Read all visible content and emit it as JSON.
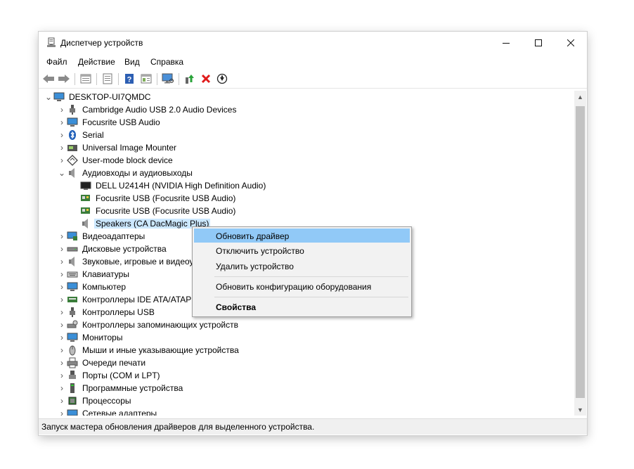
{
  "window": {
    "title": "Диспетчер устройств",
    "controls": {
      "minimize": "minimize-icon",
      "maximize": "maximize-icon",
      "close": "close-icon"
    }
  },
  "menu": [
    "Файл",
    "Действие",
    "Вид",
    "Справка"
  ],
  "toolbar_icons": [
    "back-arrow-icon",
    "forward-arrow-icon",
    "properties-icon",
    "list-view-icon",
    "help-icon",
    "device-view-icon",
    "scan-hardware-icon",
    "update-driver-icon",
    "uninstall-device-icon",
    "disable-device-icon"
  ],
  "tree": {
    "root": "DESKTOP-UI7QMDC",
    "items": [
      {
        "label": "Cambridge Audio USB 2.0 Audio Devices",
        "icon": "usb-device-icon",
        "expanded": false,
        "level": 1
      },
      {
        "label": "Focusrite USB Audio",
        "icon": "monitor-icon",
        "expanded": false,
        "level": 1
      },
      {
        "label": "Serial",
        "icon": "bluetooth-icon",
        "expanded": false,
        "level": 1
      },
      {
        "label": "Universal Image Mounter",
        "icon": "image-device-icon",
        "expanded": false,
        "level": 1
      },
      {
        "label": "User-mode block device",
        "icon": "block-device-icon",
        "expanded": false,
        "level": 1
      },
      {
        "label": "Аудиовходы и аудиовыходы",
        "icon": "speaker-icon",
        "expanded": true,
        "level": 1
      },
      {
        "label": "DELL U2414H (NVIDIA High Definition Audio)",
        "icon": "monitor-audio-icon",
        "level": 2
      },
      {
        "label": "Focusrite USB (Focusrite USB Audio)",
        "icon": "audio-card-icon",
        "level": 2
      },
      {
        "label": "Focusrite USB (Focusrite USB Audio)",
        "icon": "audio-card-icon",
        "level": 2
      },
      {
        "label": "Speakers (CA DacMagic Plus)",
        "icon": "speaker-icon",
        "level": 2,
        "selected": true
      },
      {
        "label": "Видеоадаптеры",
        "icon": "display-adapter-icon",
        "expanded": false,
        "level": 1
      },
      {
        "label": "Дисковые устройства",
        "icon": "disk-drive-icon",
        "expanded": false,
        "level": 1
      },
      {
        "label": "Звуковые, игровые и видеоустройства",
        "icon": "speaker-icon",
        "expanded": false,
        "level": 1
      },
      {
        "label": "Клавиатуры",
        "icon": "keyboard-icon",
        "expanded": false,
        "level": 1
      },
      {
        "label": "Компьютер",
        "icon": "computer-icon",
        "expanded": false,
        "level": 1
      },
      {
        "label": "Контроллеры IDE ATA/ATAPI",
        "icon": "ide-controller-icon",
        "expanded": false,
        "level": 1
      },
      {
        "label": "Контроллеры USB",
        "icon": "usb-controller-icon",
        "expanded": false,
        "level": 1
      },
      {
        "label": "Контроллеры запоминающих устройств",
        "icon": "storage-controller-icon",
        "expanded": false,
        "level": 1
      },
      {
        "label": "Мониторы",
        "icon": "monitor-icon",
        "expanded": false,
        "level": 1
      },
      {
        "label": "Мыши и иные указывающие устройства",
        "icon": "mouse-icon",
        "expanded": false,
        "level": 1
      },
      {
        "label": "Очереди печати",
        "icon": "printer-icon",
        "expanded": false,
        "level": 1
      },
      {
        "label": "Порты (COM и LPT)",
        "icon": "port-icon",
        "expanded": false,
        "level": 1
      },
      {
        "label": "Программные устройства",
        "icon": "software-device-icon",
        "expanded": false,
        "level": 1
      },
      {
        "label": "Процессоры",
        "icon": "processor-icon",
        "expanded": false,
        "level": 1
      },
      {
        "label": "Сетевые адаптеры",
        "icon": "network-adapter-icon",
        "expanded": false,
        "level": 1
      }
    ]
  },
  "context_menu": {
    "items": [
      "Обновить драйвер",
      "Отключить устройство",
      "Удалить устройство",
      "Обновить конфигурацию оборудования",
      "Свойства"
    ],
    "highlighted": "Обновить драйвер"
  },
  "status": "Запуск мастера обновления драйверов для выделенного устройства.",
  "colors": {
    "selection": "#cce8ff",
    "menu_highlight": "#91c9f7",
    "uninstall_red": "#e01b1b",
    "scrollbar_thumb": "#c2c2c2"
  }
}
